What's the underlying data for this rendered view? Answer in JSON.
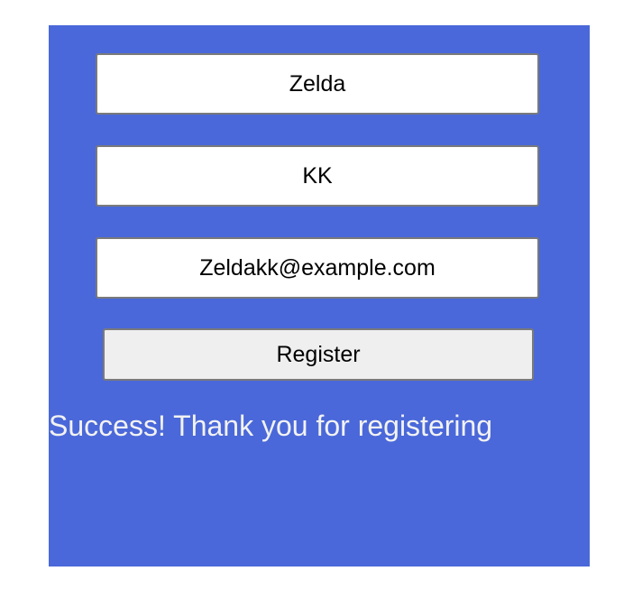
{
  "colors": {
    "panel_background": "#4a68d9",
    "field_background": "#ffffff",
    "button_background": "#efefef",
    "message_text": "#f2f2f2"
  },
  "form": {
    "first_name_value": "Zelda",
    "last_name_value": "KK",
    "email_value": "Zeldakk@example.com",
    "register_label": "Register"
  },
  "status": {
    "message": "Success! Thank you for registering"
  }
}
